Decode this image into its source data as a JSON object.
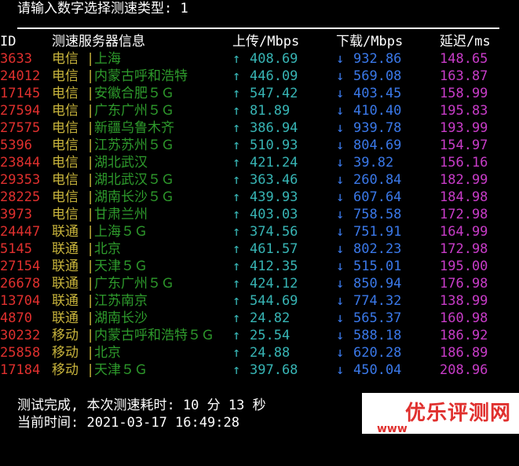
{
  "prompt": "请输入数字选择测速类型: 1",
  "header": {
    "id": "ID",
    "server": "测速服务器信息",
    "upload": "上传/Mbps",
    "download": "下载/Mbps",
    "latency": "延迟/ms"
  },
  "arrows": {
    "up": "↑",
    "down": "↓"
  },
  "separator": "|",
  "rows": [
    {
      "id": "3633",
      "isp": "电信",
      "loc": "上海",
      "up": "408.69",
      "down": "932.86",
      "lat": "148.65"
    },
    {
      "id": "24012",
      "isp": "电信",
      "loc": "内蒙古呼和浩特",
      "up": "446.09",
      "down": "569.08",
      "lat": "163.87"
    },
    {
      "id": "17145",
      "isp": "电信",
      "loc": "安徽合肥５Ｇ",
      "up": "547.42",
      "down": "403.45",
      "lat": "158.99"
    },
    {
      "id": "27594",
      "isp": "电信",
      "loc": "广东广州５Ｇ",
      "up": "81.89",
      "down": "410.40",
      "lat": "195.83"
    },
    {
      "id": "27575",
      "isp": "电信",
      "loc": "新疆乌鲁木齐",
      "up": "386.94",
      "down": "939.78",
      "lat": "193.99"
    },
    {
      "id": "5396",
      "isp": "电信",
      "loc": "江苏苏州５Ｇ",
      "up": "510.93",
      "down": "804.69",
      "lat": "154.97"
    },
    {
      "id": "23844",
      "isp": "电信",
      "loc": "湖北武汉",
      "up": "421.24",
      "down": "39.82",
      "lat": "156.16"
    },
    {
      "id": "29353",
      "isp": "电信",
      "loc": "湖北武汉５Ｇ",
      "up": "363.46",
      "down": "260.84",
      "lat": "182.99"
    },
    {
      "id": "28225",
      "isp": "电信",
      "loc": "湖南长沙５Ｇ",
      "up": "439.93",
      "down": "607.64",
      "lat": "184.98"
    },
    {
      "id": "3973",
      "isp": "电信",
      "loc": "甘肃兰州",
      "up": "403.03",
      "down": "758.58",
      "lat": "172.98"
    },
    {
      "id": "24447",
      "isp": "联通",
      "loc": "上海５Ｇ",
      "up": "374.56",
      "down": "751.91",
      "lat": "164.99"
    },
    {
      "id": "5145",
      "isp": "联通",
      "loc": "北京",
      "up": "461.57",
      "down": "802.23",
      "lat": "172.98"
    },
    {
      "id": "27154",
      "isp": "联通",
      "loc": "天津５Ｇ",
      "up": "412.35",
      "down": "515.01",
      "lat": "195.00"
    },
    {
      "id": "26678",
      "isp": "联通",
      "loc": "广东广州５Ｇ",
      "up": "424.12",
      "down": "850.94",
      "lat": "176.98"
    },
    {
      "id": "13704",
      "isp": "联通",
      "loc": "江苏南京",
      "up": "544.69",
      "down": "774.32",
      "lat": "138.99"
    },
    {
      "id": "4870",
      "isp": "联通",
      "loc": "湖南长沙",
      "up": "24.82",
      "down": "565.37",
      "lat": "160.98"
    },
    {
      "id": "30232",
      "isp": "移动",
      "loc": "内蒙古呼和浩特５Ｇ",
      "up": "25.54",
      "down": "588.18",
      "lat": "186.92"
    },
    {
      "id": "25858",
      "isp": "移动",
      "loc": "北京",
      "up": "24.88",
      "down": "620.28",
      "lat": "186.89"
    },
    {
      "id": "17184",
      "isp": "移动",
      "loc": "天津５Ｇ",
      "up": "397.68",
      "down": "450.04",
      "lat": "208.96"
    }
  ],
  "footer": {
    "elapsed": "测试完成, 本次测速耗时: 10 分 13 秒",
    "time": "当前时间: 2021-03-17 16:49:28"
  },
  "watermark": {
    "text": "优乐评测网",
    "url": "www"
  },
  "colors": {
    "id": "#e0302e",
    "isp": "#c8b43c",
    "location": "#2e9b2c",
    "upload": "#37b4b4",
    "download": "#3a78e8",
    "latency": "#c83cc8"
  }
}
